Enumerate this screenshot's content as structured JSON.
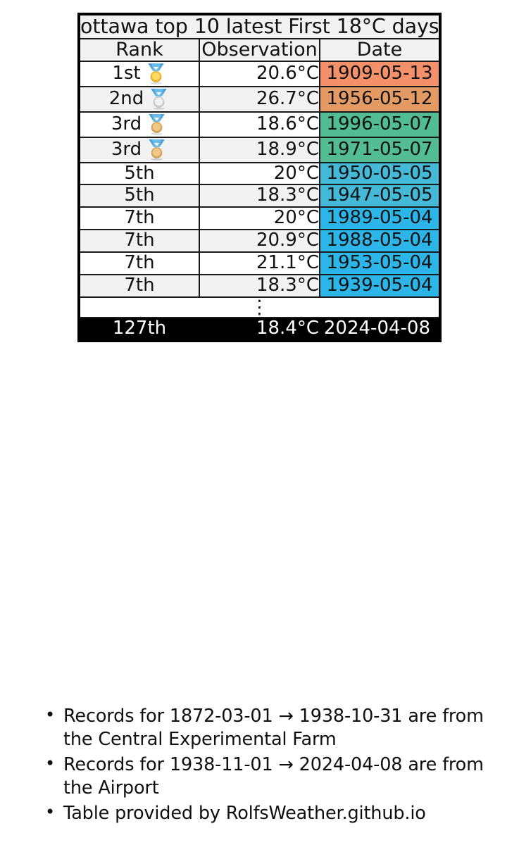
{
  "table": {
    "title": "ottawa top 10 latest First 18°C days",
    "columns": [
      "Rank",
      "Observation",
      "Date"
    ],
    "rows": [
      {
        "rank": "1st",
        "medal": "gold-medal-icon",
        "observation": "20.6°C",
        "date": "1909-05-13",
        "date_color": "#f4916b",
        "stripe": "plain"
      },
      {
        "rank": "2nd",
        "medal": "silver-medal-icon",
        "observation": "26.7°C",
        "date": "1956-05-12",
        "date_color": "#e49a63",
        "stripe": "zebra"
      },
      {
        "rank": "3rd",
        "medal": "bronze-medal-icon",
        "observation": "18.6°C",
        "date": "1996-05-07",
        "date_color": "#52bd95",
        "stripe": "plain"
      },
      {
        "rank": "3rd",
        "medal": "bronze-medal-icon",
        "observation": "18.9°C",
        "date": "1971-05-07",
        "date_color": "#52bd95",
        "stripe": "zebra"
      },
      {
        "rank": "5th",
        "medal": "",
        "observation": "20°C",
        "date": "1950-05-05",
        "date_color": "#45b9d8",
        "stripe": "plain"
      },
      {
        "rank": "5th",
        "medal": "",
        "observation": "18.3°C",
        "date": "1947-05-05",
        "date_color": "#45b9d8",
        "stripe": "zebra"
      },
      {
        "rank": "7th",
        "medal": "",
        "observation": "20°C",
        "date": "1989-05-04",
        "date_color": "#2cb5e8",
        "stripe": "plain"
      },
      {
        "rank": "7th",
        "medal": "",
        "observation": "20.9°C",
        "date": "1988-05-04",
        "date_color": "#2cb5e8",
        "stripe": "zebra"
      },
      {
        "rank": "7th",
        "medal": "",
        "observation": "21.1°C",
        "date": "1953-05-04",
        "date_color": "#2cb5e8",
        "stripe": "plain"
      },
      {
        "rank": "7th",
        "medal": "",
        "observation": "18.3°C",
        "date": "1939-05-04",
        "date_color": "#2cb5e8",
        "stripe": "zebra"
      }
    ],
    "ellipsis": "⋮",
    "final_row": {
      "rank": "127th",
      "observation": "18.4°C",
      "date": "2024-04-08"
    }
  },
  "notes": [
    "Records for 1872-03-01 → 1938-10-31 are from the Central Experimental Farm",
    "Records for 1938-11-01 → 2024-04-08 are from the Airport",
    "Table provided by RolfsWeather.github.io"
  ]
}
